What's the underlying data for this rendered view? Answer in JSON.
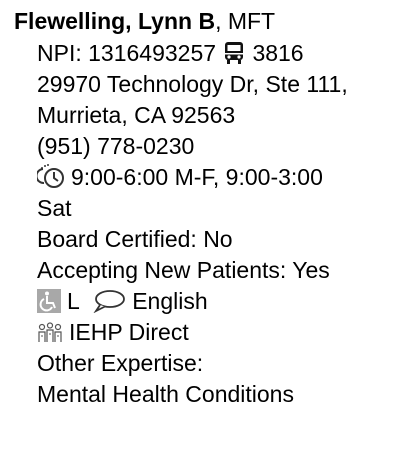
{
  "provider": {
    "name": "Flewelling, Lynn B",
    "credential": ", MFT",
    "npi_label": "NPI:",
    "npi": "1316493257",
    "bus_route": "3816",
    "address_line1": "29970 Technology Dr, Ste 111,",
    "address_line2": "Murrieta, CA 92563",
    "phone": "(951) 778-0230",
    "hours": "9:00-6:00 M-F, 9:00-3:00",
    "hours_cont": "Sat",
    "board_certified": "Board Certified: No",
    "accepting": "Accepting New Patients: Yes",
    "accessibility_level": "L",
    "language": "English",
    "network": "IEHP Direct",
    "expertise_label": "Other Expertise:",
    "expertise": "Mental Health Conditions"
  },
  "icons": {
    "bus": "bus-icon",
    "hours": "clock-icon",
    "accessibility": "wheelchair-icon",
    "language": "speech-bubble-icon",
    "network": "group-icon"
  },
  "colors": {
    "text": "#000000",
    "accessibility_icon": "#a8a8a8",
    "icon_dark": "#333333"
  }
}
